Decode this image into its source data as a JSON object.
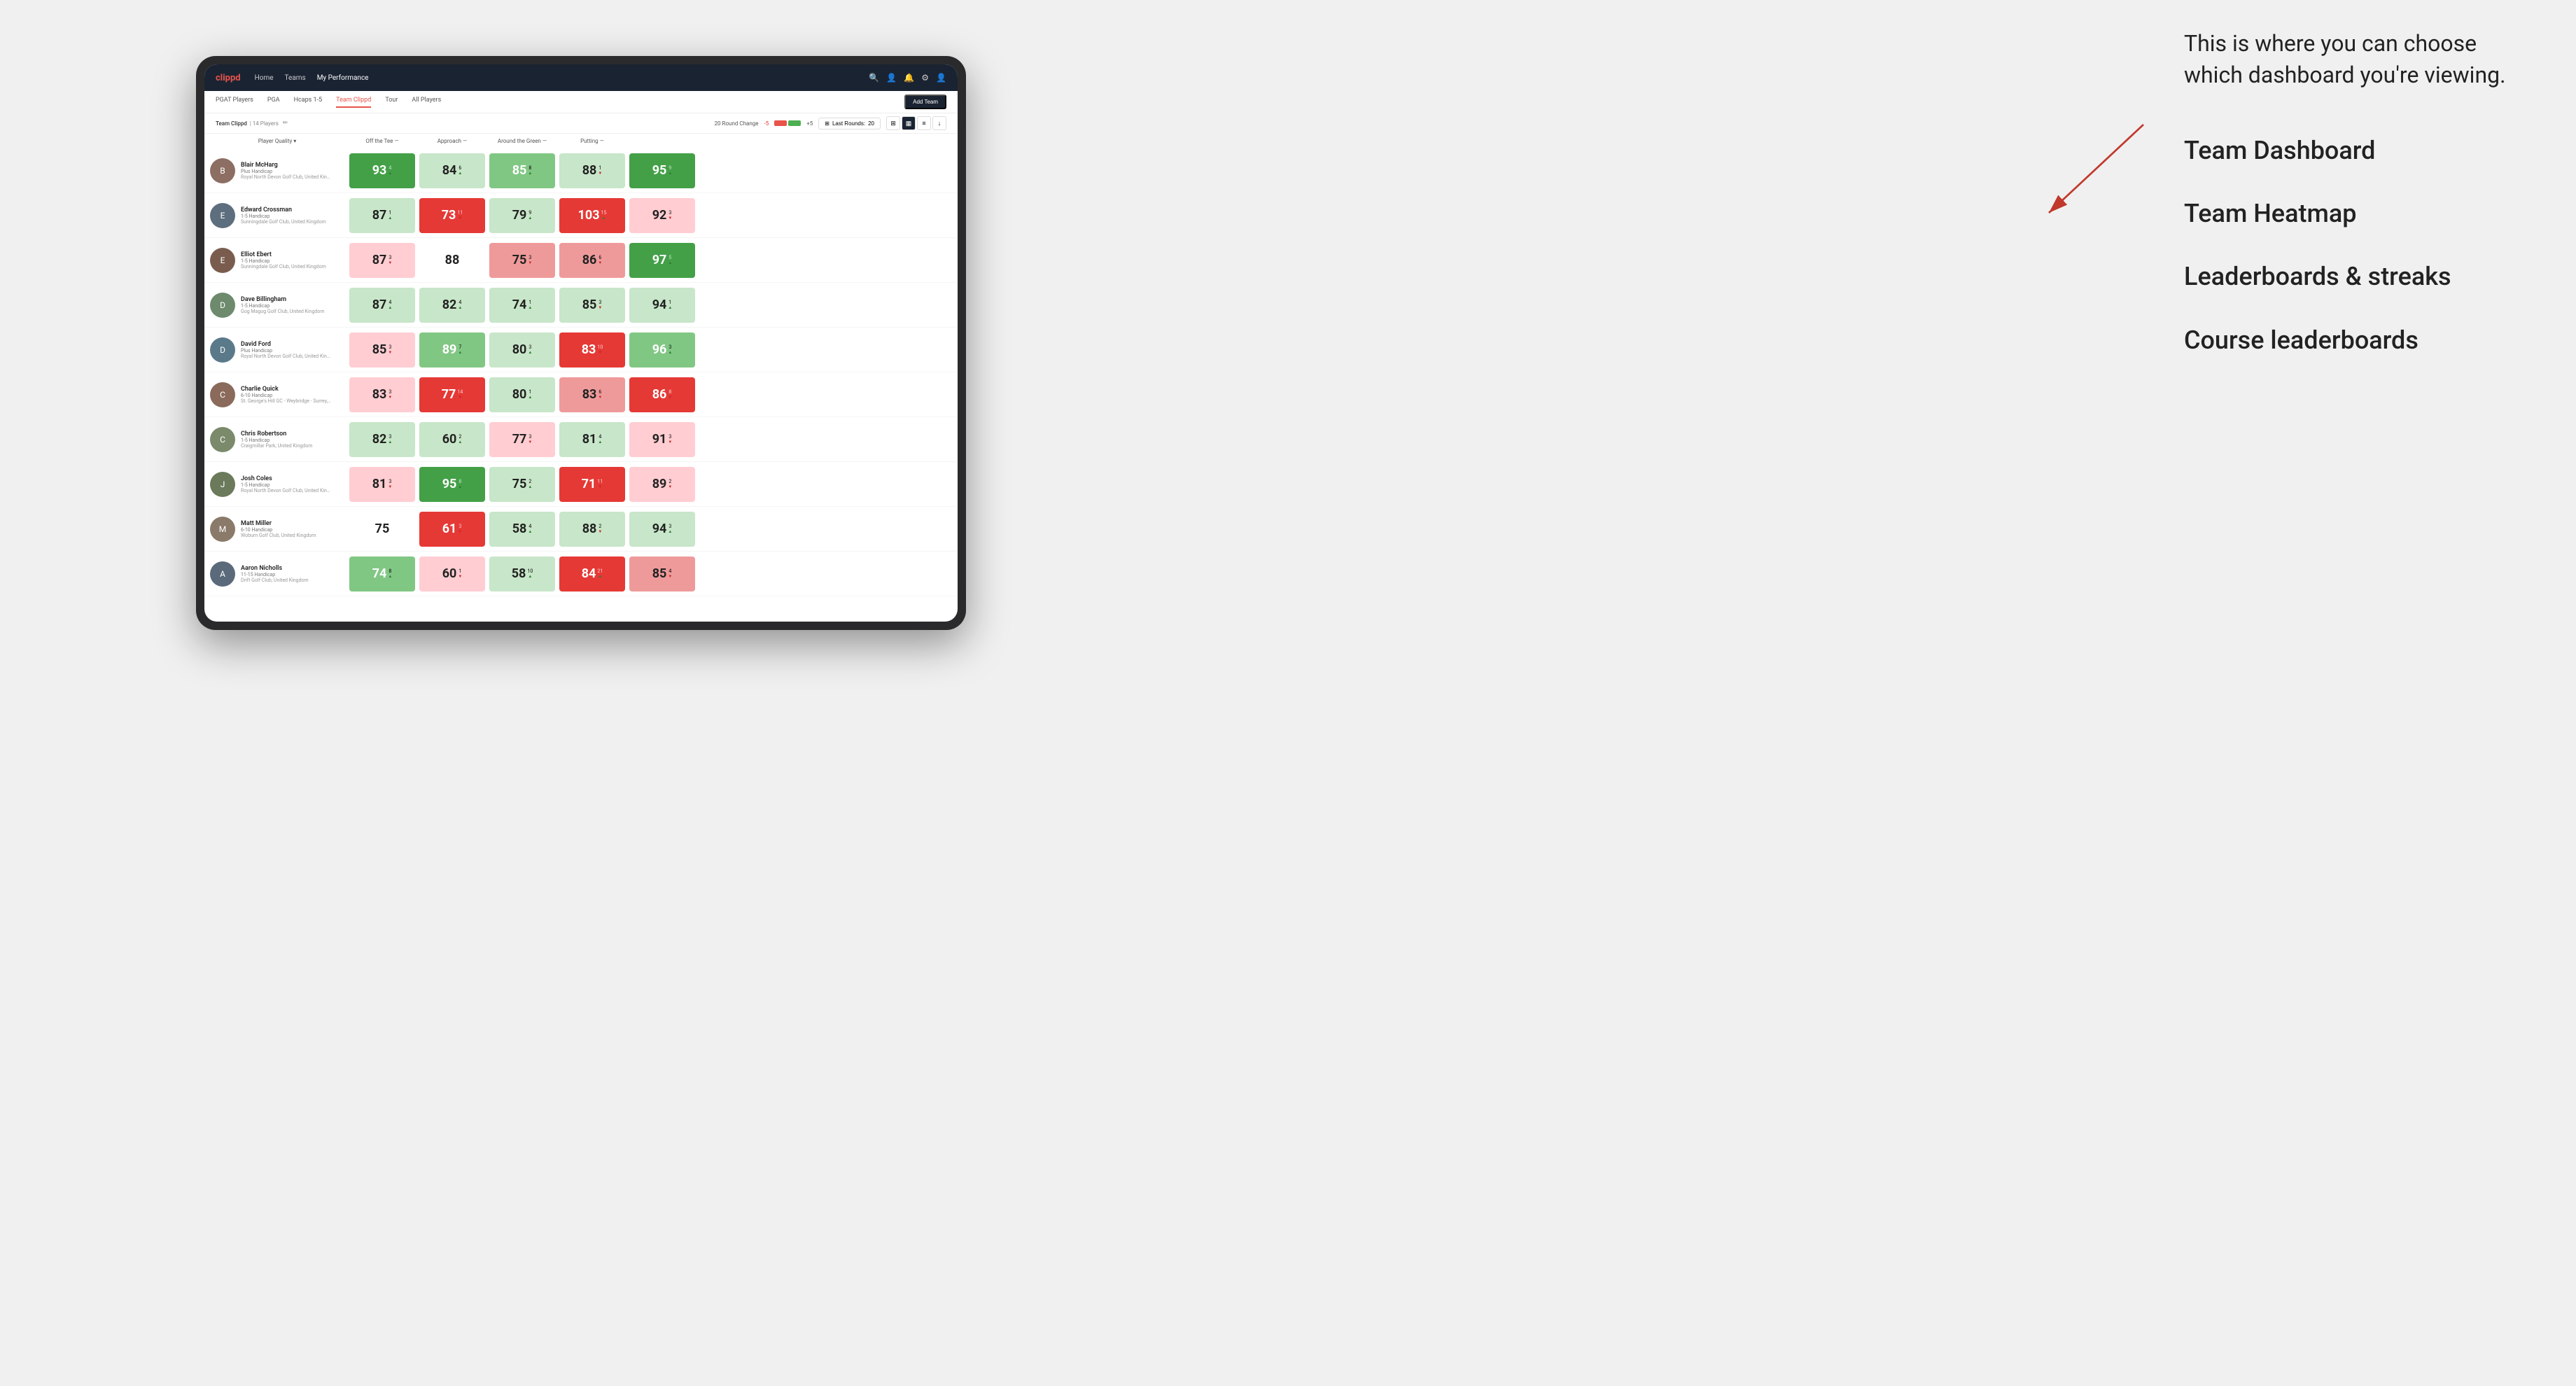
{
  "annotation": {
    "text": "This is where you can choose which dashboard you're viewing.",
    "options": [
      {
        "label": "Team Dashboard"
      },
      {
        "label": "Team Heatmap"
      },
      {
        "label": "Leaderboards & streaks"
      },
      {
        "label": "Course leaderboards"
      }
    ]
  },
  "navbar": {
    "logo": "clippd",
    "links": [
      "Home",
      "Teams",
      "My Performance"
    ],
    "active_link": "My Performance"
  },
  "subnav": {
    "tabs": [
      "PGAT Players",
      "PGA",
      "Hcaps 1-5",
      "Team Clippd",
      "Tour",
      "All Players"
    ],
    "active_tab": "Team Clippd",
    "add_team_label": "Add Team"
  },
  "team_header": {
    "name": "Team Clippd",
    "separator": "|",
    "count": "14 Players",
    "round_change_label": "20 Round Change",
    "minus_label": "-5",
    "plus_label": "+5",
    "last_rounds_label": "Last Rounds:",
    "last_rounds_value": "20"
  },
  "col_headers": [
    {
      "label": "Player Quality",
      "has_arrow": true
    },
    {
      "label": "Off the Tee",
      "has_arrow": true
    },
    {
      "label": "Approach",
      "has_arrow": true
    },
    {
      "label": "Around the Green",
      "has_arrow": true
    },
    {
      "label": "Putting",
      "has_arrow": true
    }
  ],
  "players": [
    {
      "name": "Blair McHarg",
      "handicap": "Plus Handicap",
      "club": "Royal North Devon Golf Club, United Kingdom",
      "avatar_letter": "B",
      "avatar_color": "#8d6e63",
      "scores": [
        {
          "value": "93",
          "change": "4",
          "direction": "up",
          "bg": "bg-green-strong"
        },
        {
          "value": "84",
          "change": "6",
          "direction": "up",
          "bg": "bg-green-light"
        },
        {
          "value": "85",
          "change": "8",
          "direction": "up",
          "bg": "bg-green-mid"
        },
        {
          "value": "88",
          "change": "1",
          "direction": "down",
          "bg": "bg-green-light"
        },
        {
          "value": "95",
          "change": "9",
          "direction": "up",
          "bg": "bg-green-strong"
        }
      ]
    },
    {
      "name": "Edward Crossman",
      "handicap": "1-5 Handicap",
      "club": "Sunningdale Golf Club, United Kingdom",
      "avatar_letter": "E",
      "avatar_color": "#5d6e7e",
      "scores": [
        {
          "value": "87",
          "change": "1",
          "direction": "up",
          "bg": "bg-green-light"
        },
        {
          "value": "73",
          "change": "11",
          "direction": "down",
          "bg": "bg-red-strong"
        },
        {
          "value": "79",
          "change": "9",
          "direction": "up",
          "bg": "bg-green-light"
        },
        {
          "value": "103",
          "change": "15",
          "direction": "up",
          "bg": "bg-red-strong"
        },
        {
          "value": "92",
          "change": "3",
          "direction": "down",
          "bg": "bg-red-light"
        }
      ]
    },
    {
      "name": "Elliot Ebert",
      "handicap": "1-5 Handicap",
      "club": "Sunningdale Golf Club, United Kingdom",
      "avatar_letter": "E",
      "avatar_color": "#7a5c4e",
      "scores": [
        {
          "value": "87",
          "change": "3",
          "direction": "down",
          "bg": "bg-red-light"
        },
        {
          "value": "88",
          "change": "",
          "direction": "",
          "bg": "bg-white"
        },
        {
          "value": "75",
          "change": "3",
          "direction": "down",
          "bg": "bg-red-mid"
        },
        {
          "value": "86",
          "change": "6",
          "direction": "down",
          "bg": "bg-red-mid"
        },
        {
          "value": "97",
          "change": "5",
          "direction": "up",
          "bg": "bg-green-strong"
        }
      ]
    },
    {
      "name": "Dave Billingham",
      "handicap": "1-5 Handicap",
      "club": "Gog Magog Golf Club, United Kingdom",
      "avatar_letter": "D",
      "avatar_color": "#6d8a6d",
      "scores": [
        {
          "value": "87",
          "change": "4",
          "direction": "up",
          "bg": "bg-green-light"
        },
        {
          "value": "82",
          "change": "4",
          "direction": "up",
          "bg": "bg-green-light"
        },
        {
          "value": "74",
          "change": "1",
          "direction": "up",
          "bg": "bg-green-light"
        },
        {
          "value": "85",
          "change": "3",
          "direction": "down",
          "bg": "bg-green-light"
        },
        {
          "value": "94",
          "change": "1",
          "direction": "up",
          "bg": "bg-green-light"
        }
      ]
    },
    {
      "name": "David Ford",
      "handicap": "Plus Handicap",
      "club": "Royal North Devon Golf Club, United Kingdom",
      "avatar_letter": "D",
      "avatar_color": "#5a7a8a",
      "scores": [
        {
          "value": "85",
          "change": "3",
          "direction": "down",
          "bg": "bg-red-light"
        },
        {
          "value": "89",
          "change": "7",
          "direction": "up",
          "bg": "bg-green-mid"
        },
        {
          "value": "80",
          "change": "3",
          "direction": "up",
          "bg": "bg-green-light"
        },
        {
          "value": "83",
          "change": "10",
          "direction": "down",
          "bg": "bg-red-strong"
        },
        {
          "value": "96",
          "change": "3",
          "direction": "up",
          "bg": "bg-green-mid"
        }
      ]
    },
    {
      "name": "Charlie Quick",
      "handicap": "6-10 Handicap",
      "club": "St. George's Hill GC - Weybridge - Surrey, Uni...",
      "avatar_letter": "C",
      "avatar_color": "#8a6a5a",
      "scores": [
        {
          "value": "83",
          "change": "3",
          "direction": "down",
          "bg": "bg-red-light"
        },
        {
          "value": "77",
          "change": "14",
          "direction": "down",
          "bg": "bg-red-strong"
        },
        {
          "value": "80",
          "change": "1",
          "direction": "up",
          "bg": "bg-green-light"
        },
        {
          "value": "83",
          "change": "6",
          "direction": "down",
          "bg": "bg-red-mid"
        },
        {
          "value": "86",
          "change": "8",
          "direction": "down",
          "bg": "bg-red-strong"
        }
      ]
    },
    {
      "name": "Chris Robertson",
      "handicap": "1-5 Handicap",
      "club": "Craigmillar Park, United Kingdom",
      "avatar_letter": "C",
      "avatar_color": "#7a8a6a",
      "scores": [
        {
          "value": "82",
          "change": "3",
          "direction": "up",
          "bg": "bg-green-light"
        },
        {
          "value": "60",
          "change": "2",
          "direction": "up",
          "bg": "bg-green-light"
        },
        {
          "value": "77",
          "change": "3",
          "direction": "down",
          "bg": "bg-red-light"
        },
        {
          "value": "81",
          "change": "4",
          "direction": "up",
          "bg": "bg-green-light"
        },
        {
          "value": "91",
          "change": "3",
          "direction": "down",
          "bg": "bg-red-light"
        }
      ]
    },
    {
      "name": "Josh Coles",
      "handicap": "1-5 Handicap",
      "club": "Royal North Devon Golf Club, United Kingdom",
      "avatar_letter": "J",
      "avatar_color": "#6a7a5a",
      "scores": [
        {
          "value": "81",
          "change": "3",
          "direction": "down",
          "bg": "bg-red-light"
        },
        {
          "value": "95",
          "change": "8",
          "direction": "up",
          "bg": "bg-green-strong"
        },
        {
          "value": "75",
          "change": "2",
          "direction": "up",
          "bg": "bg-green-light"
        },
        {
          "value": "71",
          "change": "11",
          "direction": "down",
          "bg": "bg-red-strong"
        },
        {
          "value": "89",
          "change": "2",
          "direction": "down",
          "bg": "bg-red-light"
        }
      ]
    },
    {
      "name": "Matt Miller",
      "handicap": "6-10 Handicap",
      "club": "Woburn Golf Club, United Kingdom",
      "avatar_letter": "M",
      "avatar_color": "#8a7a6a",
      "scores": [
        {
          "value": "75",
          "change": "",
          "direction": "",
          "bg": "bg-white"
        },
        {
          "value": "61",
          "change": "3",
          "direction": "down",
          "bg": "bg-red-strong"
        },
        {
          "value": "58",
          "change": "4",
          "direction": "up",
          "bg": "bg-green-light"
        },
        {
          "value": "88",
          "change": "2",
          "direction": "down",
          "bg": "bg-green-light"
        },
        {
          "value": "94",
          "change": "3",
          "direction": "up",
          "bg": "bg-green-light"
        }
      ]
    },
    {
      "name": "Aaron Nicholls",
      "handicap": "11-15 Handicap",
      "club": "Drift Golf Club, United Kingdom",
      "avatar_letter": "A",
      "avatar_color": "#5a6a7a",
      "scores": [
        {
          "value": "74",
          "change": "8",
          "direction": "up",
          "bg": "bg-green-mid"
        },
        {
          "value": "60",
          "change": "1",
          "direction": "down",
          "bg": "bg-red-light"
        },
        {
          "value": "58",
          "change": "10",
          "direction": "up",
          "bg": "bg-green-light"
        },
        {
          "value": "84",
          "change": "21",
          "direction": "up",
          "bg": "bg-red-strong"
        },
        {
          "value": "85",
          "change": "4",
          "direction": "down",
          "bg": "bg-red-mid"
        }
      ]
    }
  ]
}
